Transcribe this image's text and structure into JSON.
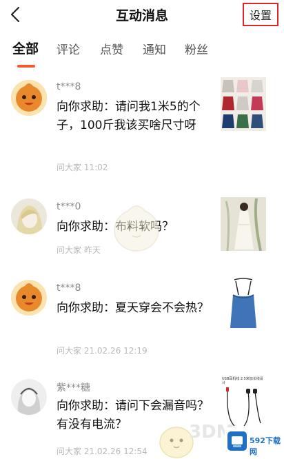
{
  "header": {
    "title": "互动消息",
    "settings_label": "设置"
  },
  "tabs": [
    {
      "label": "全部",
      "active": true
    },
    {
      "label": "评论",
      "active": false
    },
    {
      "label": "点赞",
      "active": false
    },
    {
      "label": "通知",
      "active": false
    },
    {
      "label": "粉丝",
      "active": false
    }
  ],
  "messages": [
    {
      "user": "t***8",
      "content": "向你求助：请问我1米5的个子，100斤我该买啥尺寸呀",
      "meta": "问大家 11:02",
      "image": "clothing-grid-thumbnail"
    },
    {
      "user": "t***0",
      "content": "向你求助：布料软吗？",
      "meta": "问大家 昨天",
      "image": "white-dress-thumbnail"
    },
    {
      "user": "t***8",
      "content": "向你求助：夏天穿会不会热？",
      "meta": "问大家 21.02.26 12:19",
      "image": "blue-camisole-thumbnail"
    },
    {
      "user": "紫***糖",
      "content": "向你求助：请问下会漏音吗？有没有电流？",
      "meta": "问大家 21.02.26 12:54",
      "image": "earphones-thumbnail",
      "image_caption": "USB耳机线 2.5米加长线设计"
    }
  ],
  "watermark": {
    "left_text": "3DM",
    "right_text": "592下载网"
  },
  "colors": {
    "accent": "#f05a28",
    "highlight_border": "#e0242b",
    "meta_gray": "#b8b8b8"
  }
}
